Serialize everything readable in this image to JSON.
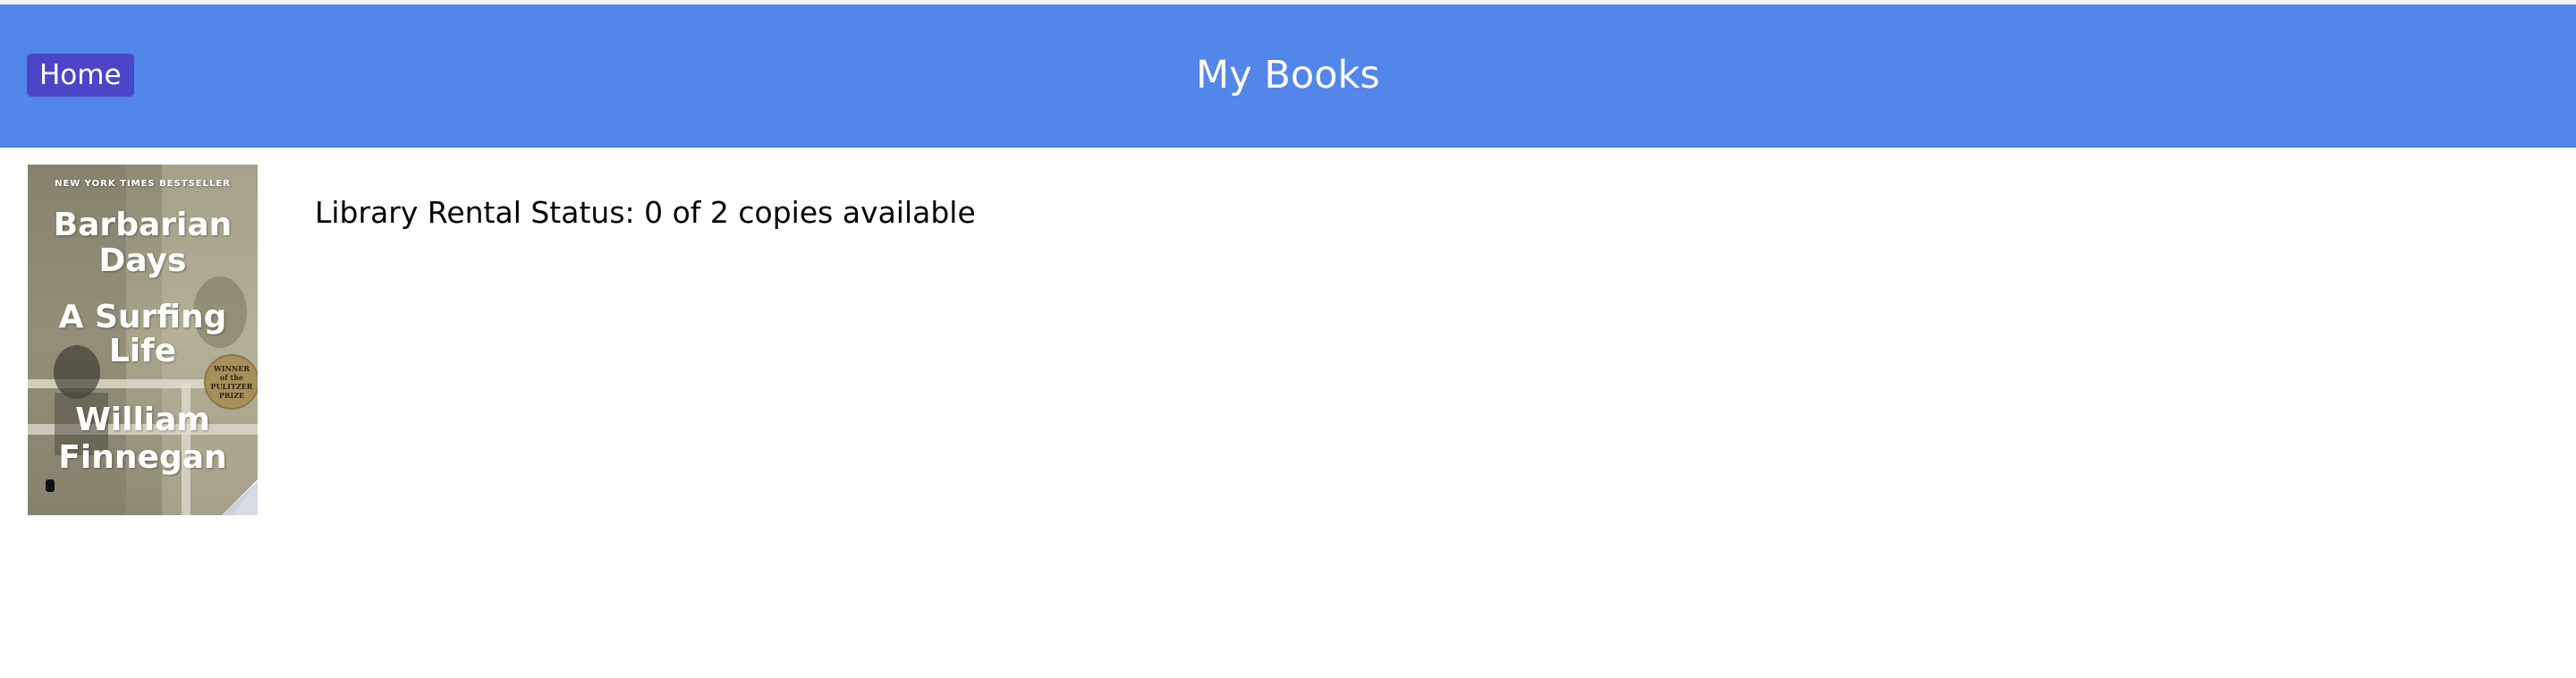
{
  "header": {
    "home_label": "Home",
    "title": "My Books",
    "background": "#5286ea",
    "home_button_color": "#4b46c8"
  },
  "book": {
    "cover": {
      "bestseller_line": "NEW YORK TIMES BESTSELLER",
      "title_line_1": "Barbarian",
      "title_line_2": "Days",
      "subtitle_line_1": "A Surfing",
      "subtitle_line_2": "Life",
      "author_line_1": "William",
      "author_line_2": "Finnegan",
      "seal_line_1": "WINNER",
      "seal_line_2": "of the",
      "seal_line_3": "PULITZER",
      "seal_line_4": "PRIZE"
    },
    "rental_status": "Library Rental Status: 0 of 2 copies available"
  }
}
